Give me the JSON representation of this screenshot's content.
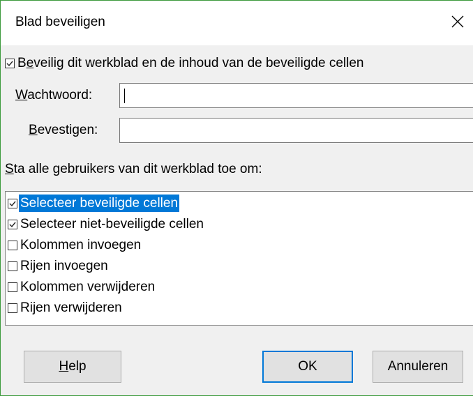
{
  "dialog": {
    "title": "Blad beveiligen"
  },
  "protect": {
    "checked": true,
    "label_first": "B",
    "label_mnemonic": "e",
    "label_rest": "veilig dit werkblad en de inhoud van de beveiligde cellen"
  },
  "password": {
    "label_mnemonic": "W",
    "label_rest": "achtwoord:",
    "value": ""
  },
  "confirm": {
    "label_mnemonic": "B",
    "label_rest": "evestigen:",
    "value": ""
  },
  "permissions": {
    "label_mnemonic": "S",
    "label_rest": "ta alle gebruikers van dit werkblad toe om:",
    "items": [
      {
        "label": "Selecteer beveiligde cellen",
        "checked": true,
        "selected": true
      },
      {
        "label": "Selecteer niet-beveiligde cellen",
        "checked": true,
        "selected": false
      },
      {
        "label": "Kolommen invoegen",
        "checked": false,
        "selected": false
      },
      {
        "label": "Rijen invoegen",
        "checked": false,
        "selected": false
      },
      {
        "label": "Kolommen verwijderen",
        "checked": false,
        "selected": false
      },
      {
        "label": "Rijen verwijderen",
        "checked": false,
        "selected": false
      }
    ]
  },
  "buttons": {
    "help_mnemonic": "H",
    "help_rest": "elp",
    "ok": "OK",
    "cancel": "Annuleren"
  },
  "colors": {
    "selection": "#0078d7",
    "window_border": "#3c9a3c",
    "dialog_bg": "#f0f0f0"
  },
  "icons": {
    "close": "close-icon",
    "check": "checkmark-icon"
  }
}
